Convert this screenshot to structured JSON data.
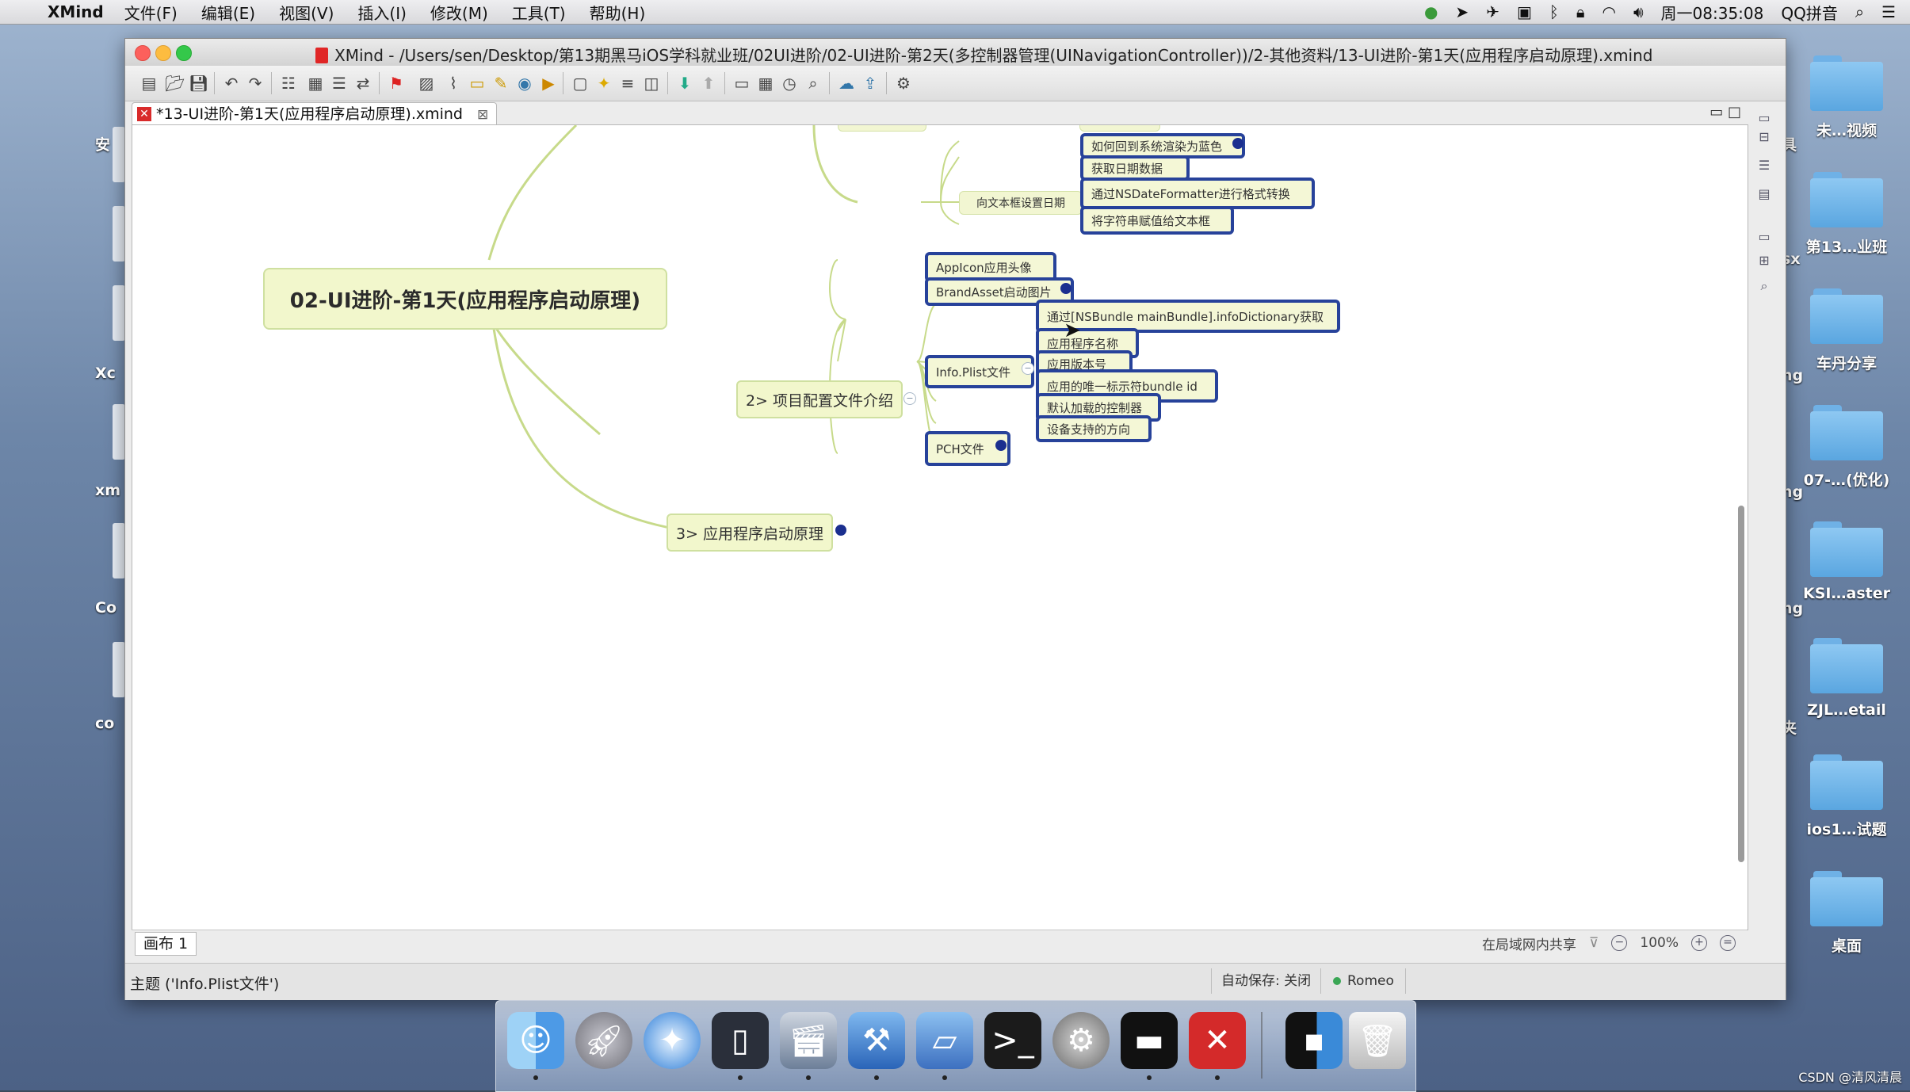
{
  "menubar": {
    "app_name": "XMind",
    "items": [
      "文件(F)",
      "编辑(E)",
      "视图(V)",
      "插入(I)",
      "修改(M)",
      "工具(T)",
      "帮助(H)"
    ],
    "clock": "周一08:35:08",
    "input_method": "QQ拼音"
  },
  "window": {
    "title": "XMind - /Users/sen/Desktop/第13期黑马iOS学科就业班/02UI进阶/02-UI进阶-第2天(多控制器管理(UINavigationController))/2-其他资料/13-UI进阶-第1天(应用程序启动原理).xmind",
    "tab_label": "*13-UI进阶-第1天(应用程序启动原理).xmind"
  },
  "mindmap": {
    "central": "02-UI进阶-第1天(应用程序启动原理)",
    "main2": "2> 项目配置文件介绍",
    "main3": "3> 应用程序启动原理",
    "date_parent": "向文本框设置日期",
    "top_items": [
      "如何回到系统渲染为蓝色",
      "获取日期数据",
      "通过NSDateFormatter进行格式转换",
      "将字符串赋值给文本框"
    ],
    "appicon": "AppIcon应用头像",
    "brandasset": "BrandAsset启动图片",
    "infoplist": "Info.Plist文件",
    "pch": "PCH文件",
    "plist_items": [
      "通过[NSBundle mainBundle].infoDictionary获取",
      "应用程序名称",
      "应用版本号",
      "应用的唯一标示符bundle id",
      "默认加载的控制器",
      "设备支持的方向"
    ]
  },
  "sheet": {
    "tab": "画布 1",
    "share": "在局域网内共享",
    "zoom": "100%"
  },
  "status": {
    "topic": "主题 ('Info.Plist文件')",
    "autosave": "自动保存: 关闭",
    "user": "Romeo"
  },
  "desktop": {
    "right_folders": [
      "未…视频",
      "第13…业班",
      "车丹分享",
      "07-…(优化)",
      "KSI…aster",
      "ZJL…etail",
      "ios1…试题",
      "桌面"
    ],
    "left_labels": [
      "安",
      "Xc",
      "xm",
      "Co",
      "co"
    ],
    "side_labels": [
      "具",
      "sx",
      "ng",
      "ng",
      "ng",
      "夹"
    ]
  },
  "watermark": "CSDN @清风清晨"
}
